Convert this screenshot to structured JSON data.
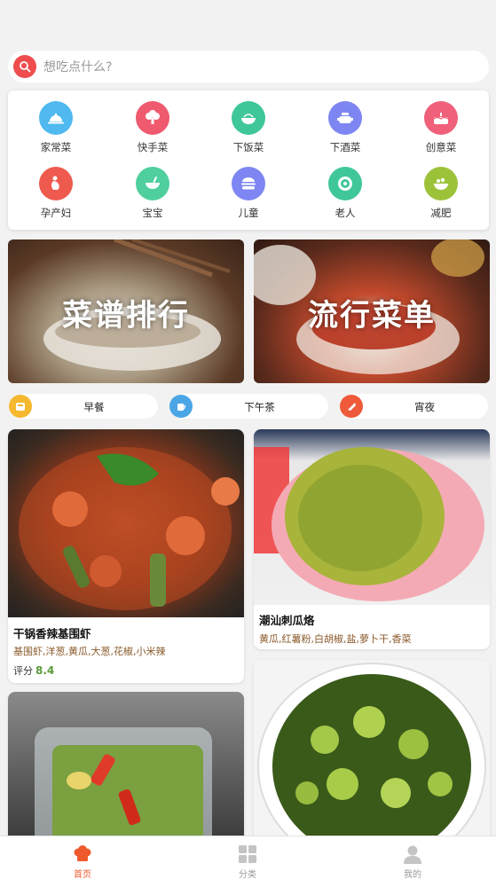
{
  "search": {
    "placeholder": "想吃点什么?"
  },
  "categories": [
    {
      "label": "家常菜",
      "icon": "dome-plate-icon",
      "color": "#4fb9f0"
    },
    {
      "label": "快手菜",
      "icon": "broccoli-icon",
      "color": "#ef5a6e"
    },
    {
      "label": "下饭菜",
      "icon": "rice-bowl-icon",
      "color": "#3fc79a"
    },
    {
      "label": "下酒菜",
      "icon": "hotpot-icon",
      "color": "#7d86f2"
    },
    {
      "label": "创意菜",
      "icon": "cake-icon",
      "color": "#f0607a"
    },
    {
      "label": "孕产妇",
      "icon": "pregnant-icon",
      "color": "#ef5a4e"
    },
    {
      "label": "宝宝",
      "icon": "baby-bowl-icon",
      "color": "#4fcf9e"
    },
    {
      "label": "儿童",
      "icon": "burger-icon",
      "color": "#7d86f2"
    },
    {
      "label": "老人",
      "icon": "soup-bowl-icon",
      "color": "#3fc79a"
    },
    {
      "label": "减肥",
      "icon": "salad-icon",
      "color": "#9cc23a"
    }
  ],
  "banners": [
    {
      "title": "菜谱排行"
    },
    {
      "title": "流行菜单"
    }
  ],
  "meal_tabs": [
    {
      "label": "早餐",
      "icon": "breakfast-icon",
      "color": "#f5b82e"
    },
    {
      "label": "下午茶",
      "icon": "tea-icon",
      "color": "#4ba6e6"
    },
    {
      "label": "宵夜",
      "icon": "midnight-snack-icon",
      "color": "#ef5a3a"
    }
  ],
  "recipes": [
    {
      "title": "干锅香辣基围虾",
      "ingredients": "基围虾,洋葱,黄瓜,大葱,花椒,小米辣",
      "rating_label": "评分",
      "rating": "8.4"
    },
    {
      "title": "潮汕刺瓜烙",
      "ingredients": "黄瓜,红薯粉,白胡椒,盐,萝卜干,香菜"
    }
  ],
  "tabbar": [
    {
      "label": "首页",
      "icon": "home-chef-icon"
    },
    {
      "label": "分类",
      "icon": "grid-icon"
    },
    {
      "label": "我的",
      "icon": "user-icon"
    }
  ],
  "colors": {
    "accent": "#ee5a2c",
    "search_icon": "#ef4d4d",
    "rating": "#5a9a3a"
  }
}
